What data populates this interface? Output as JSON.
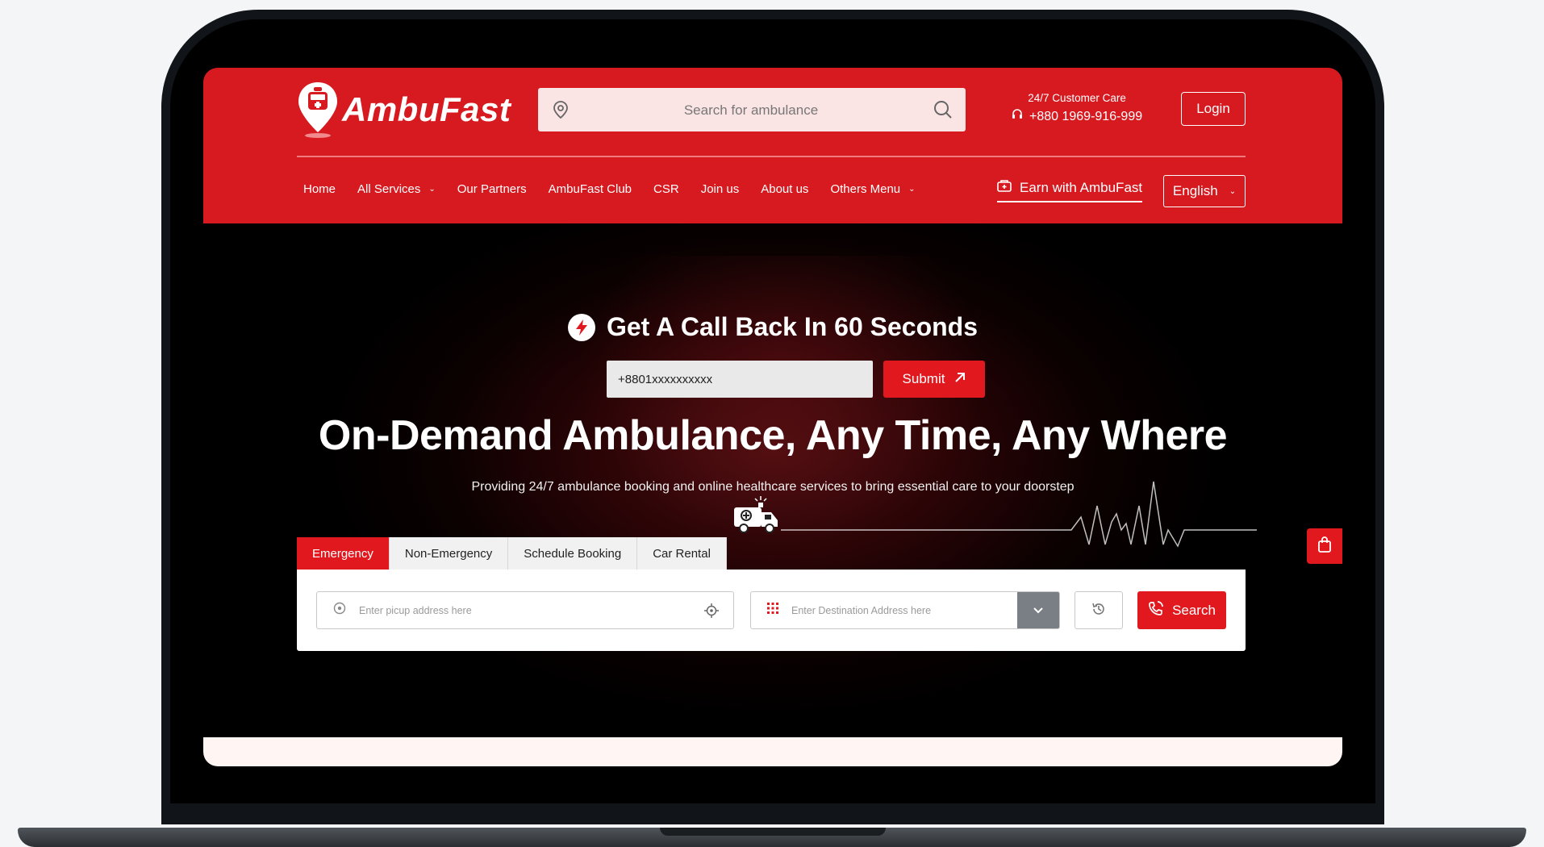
{
  "brand": {
    "name": "AmbuFast"
  },
  "search": {
    "placeholder": "Search for ambulance"
  },
  "customer_care": {
    "title": "24/7 Customer Care",
    "phone": "+880 1969-916-999"
  },
  "header": {
    "login_label": "Login",
    "earn_label": "Earn with AmbuFast",
    "language": "English"
  },
  "nav": {
    "items": [
      {
        "label": "Home"
      },
      {
        "label": "All Services"
      },
      {
        "label": "Our Partners"
      },
      {
        "label": "AmbuFast Club"
      },
      {
        "label": "CSR"
      },
      {
        "label": "Join us"
      },
      {
        "label": "About us"
      },
      {
        "label": "Others Menu"
      }
    ]
  },
  "hero": {
    "callback_title": "Get A Call Back In 60 Seconds",
    "phone_value": "+8801xxxxxxxxxx",
    "submit_label": "Submit",
    "headline": "On-Demand Ambulance, Any Time, Any Where",
    "subline": "Providing 24/7 ambulance booking and online healthcare services to bring essential care to your doorstep"
  },
  "booking": {
    "tabs": [
      {
        "label": "Emergency",
        "active": true
      },
      {
        "label": "Non-Emergency"
      },
      {
        "label": "Schedule Booking"
      },
      {
        "label": "Car Rental"
      }
    ],
    "pickup_placeholder": "Enter picup address here",
    "destination_placeholder": "Enter Destination Address here",
    "search_label": "Search"
  },
  "icons": {
    "logo": "ambulance-pin-icon",
    "search_pin": "location-pin-icon",
    "search": "search-icon",
    "headset": "headset-icon",
    "earn": "wallet-icon",
    "bolt": "lightning-icon",
    "arrow": "arrow-up-right-icon",
    "pickup": "target-icon",
    "locate": "crosshair-icon",
    "destination": "grid-dots-icon",
    "history": "history-icon",
    "search_btn": "phone-call-icon",
    "cart": "shopping-bag-icon"
  },
  "colors": {
    "brand_red": "#d71920",
    "accent_red": "#e1191f",
    "dropdown_grey": "#7a7f86"
  }
}
